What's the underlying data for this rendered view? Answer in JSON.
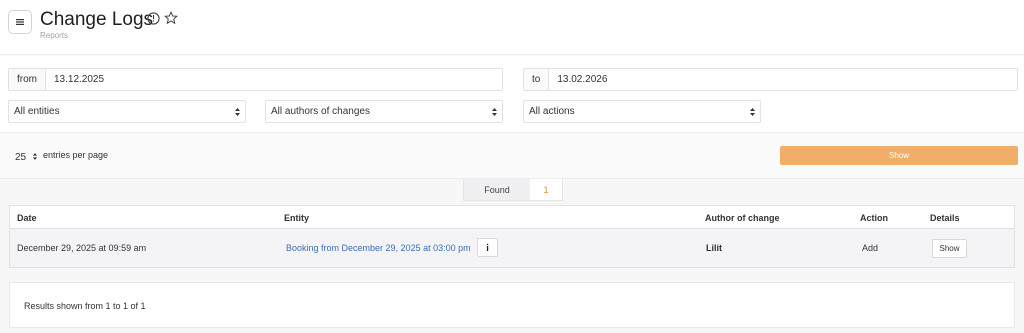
{
  "header": {
    "title": "Change Logs",
    "subtitle": "Reports"
  },
  "filters": {
    "from_label": "from",
    "from_value": "13.12.2025",
    "to_label": "to",
    "to_value": "13.02.2026",
    "entities_select": "All entities",
    "authors_select": "All authors of changes",
    "actions_select": "All actions"
  },
  "controls": {
    "per_page_value": "25",
    "per_page_label": "entries per page",
    "show_button": "Show"
  },
  "found": {
    "label": "Found",
    "count": "1"
  },
  "table": {
    "columns": [
      "Date",
      "Entity",
      "Author of change",
      "Action",
      "Details"
    ],
    "rows": [
      {
        "date": "December 29, 2025 at 09:59 am",
        "entity": "Booking from December 29, 2025 at 03:00 pm",
        "author": "Lilit",
        "action": "Add",
        "details_button": "Show"
      }
    ]
  },
  "footer": {
    "results_text": "Results shown from 1 to 1 of 1"
  },
  "colors": {
    "accent": "#f0ae69",
    "link": "#3b6eb5",
    "count": "#e58e30"
  }
}
